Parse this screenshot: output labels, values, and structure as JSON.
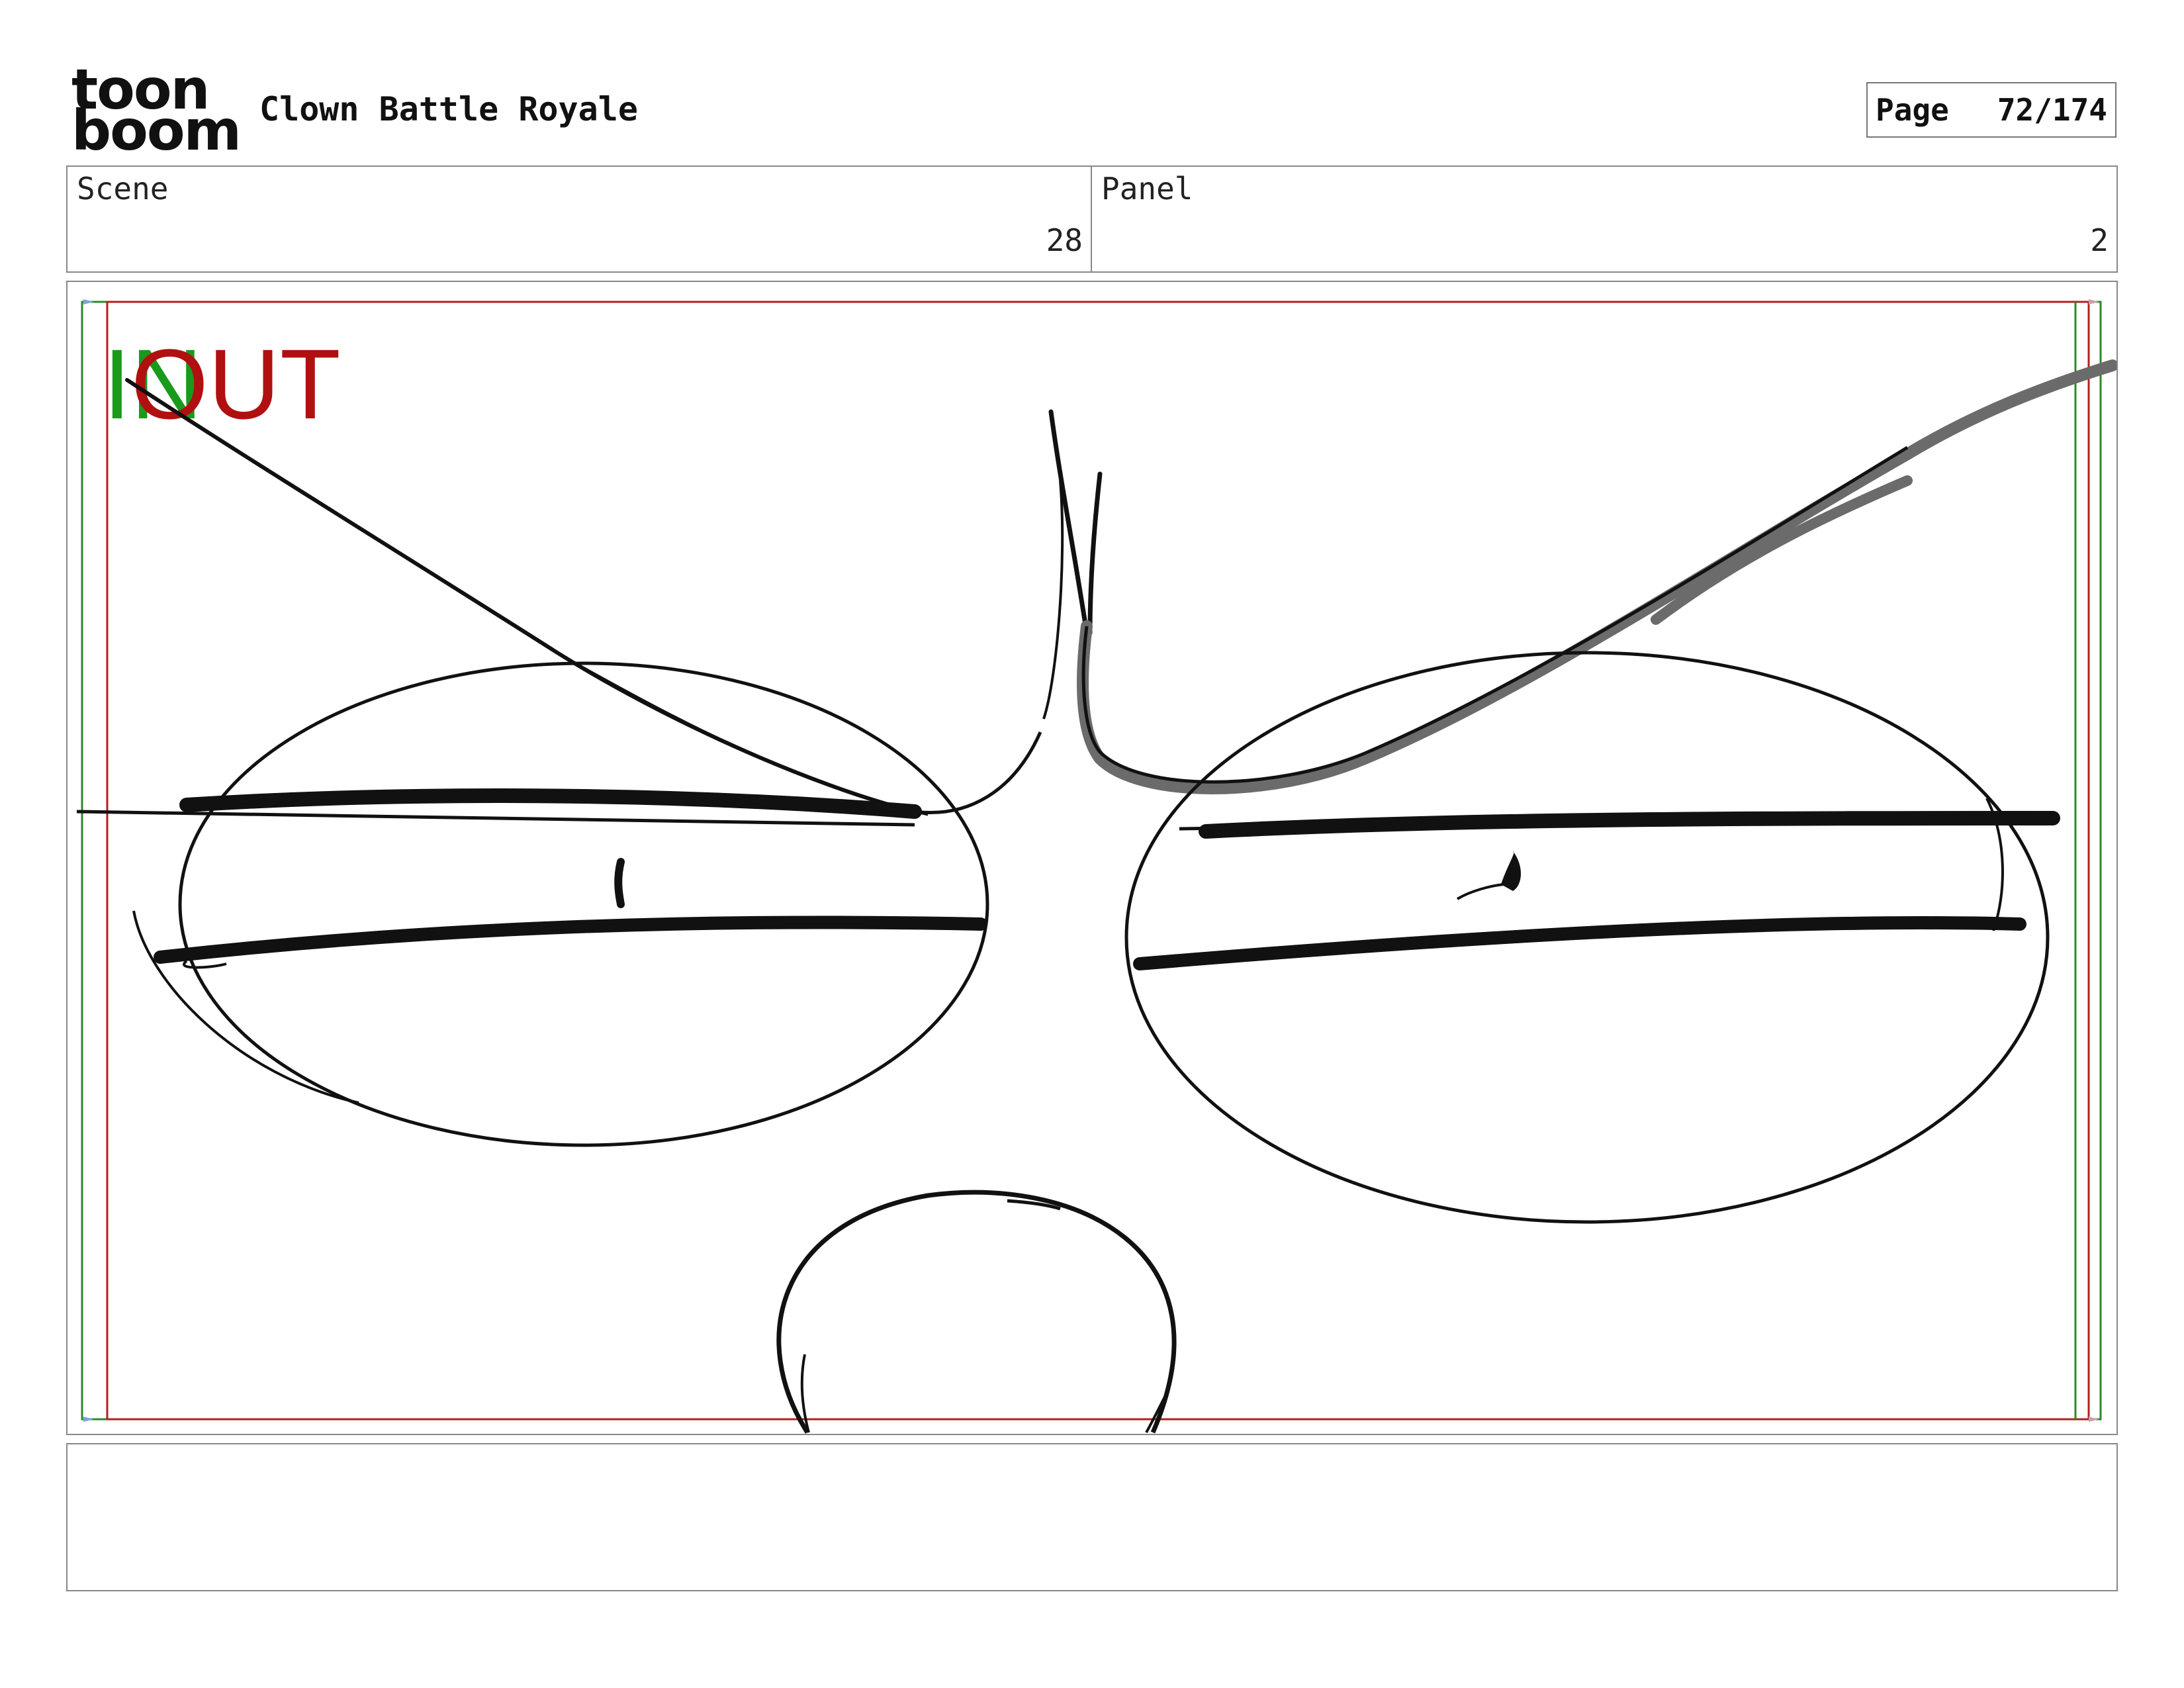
{
  "header": {
    "logo_line1": "toon",
    "logo_line2": "boom",
    "project_title": "Clown Battle Royale",
    "page_label": "Page",
    "page_number": "72/174"
  },
  "info": {
    "scene_label": "Scene",
    "scene_value": "28",
    "panel_label": "Panel",
    "panel_value": "2"
  },
  "frame": {
    "in_marker": "IN",
    "out_marker": "OUT",
    "colors": {
      "in_green": "#1a9a1a",
      "out_red": "#b01010",
      "safe_line_green": "#2a8a2a",
      "safe_line_red": "#b02020",
      "ink": "#111111",
      "shade": "#6b6b6b"
    }
  },
  "notes": {
    "text": ""
  }
}
